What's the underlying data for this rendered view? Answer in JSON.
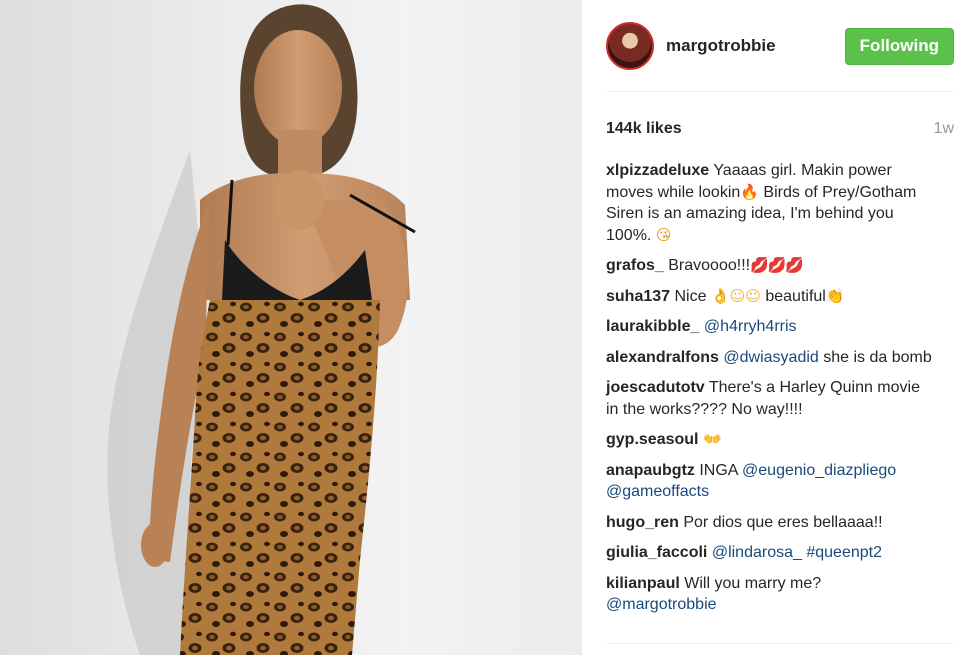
{
  "post": {
    "image_alt": "Woman in leopard-print dress against a white wall",
    "author": "margotrobbie",
    "follow_button": "Following",
    "likes": "144k likes",
    "time": "1w"
  },
  "colors": {
    "follow_green": "#5bc14a",
    "link_blue": "#1a4a7b",
    "time_gray": "#999999"
  },
  "comments": [
    {
      "user": "xlpizzadeluxe",
      "t1": "Yaaaas girl. Makin power moves while lookin",
      "e1": "🔥",
      "t2": " Birds of Prey/Gotham Siren is an amazing idea, I'm behind you 100%. ",
      "e2": "😘"
    },
    {
      "user": "grafos_",
      "t1": "Bravoooo!!!",
      "e1": "💋💋💋"
    },
    {
      "user": "suha137",
      "t1": "Nice ",
      "e1": "👌☺☺",
      "t2": " beautiful",
      "e2": "👏"
    },
    {
      "user": "laurakibble_",
      "link1": "@h4rryh4rris"
    },
    {
      "user": "alexandralfons",
      "link1": "@dwiasyadid",
      "t1": " she is da bomb"
    },
    {
      "user": "joescadutotv",
      "t1": "There's a Harley Quinn movie in the works???? No way!!!!"
    },
    {
      "user": "gyp.seasoul",
      "e1": "👐"
    },
    {
      "user": "anapaubgtz",
      "t1": "INGA ",
      "link1": "@eugenio_diazpliego",
      "link2": "@gameoffacts"
    },
    {
      "user": "hugo_ren",
      "t1": "Por dios que eres bellaaaa!!"
    },
    {
      "user": "giulia_faccoli",
      "link1": "@lindarosa_",
      "link2": "#queenpt2"
    },
    {
      "user": "kilianpaul",
      "t1": "Will you marry me?",
      "link1": "@margotrobbie"
    }
  ]
}
